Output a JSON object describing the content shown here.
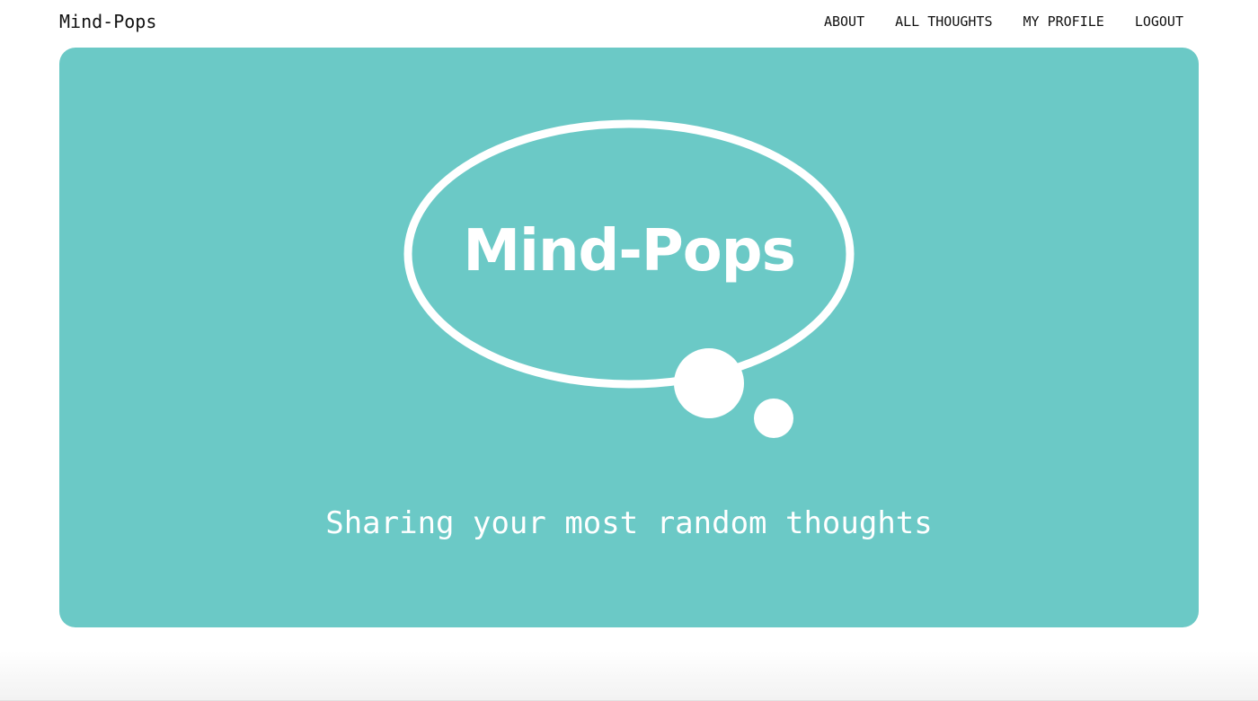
{
  "navbar": {
    "brand": "Mind-Pops",
    "links": [
      {
        "label": "ABOUT"
      },
      {
        "label": "ALL THOUGHTS"
      },
      {
        "label": "MY PROFILE"
      },
      {
        "label": "LOGOUT"
      }
    ]
  },
  "hero": {
    "logo_text": "Mind-Pops",
    "tagline": "Sharing your most random thoughts"
  },
  "colors": {
    "hero_background": "#6BC9C6",
    "logo": "#FFFFFF",
    "nav_text": "#111111"
  },
  "icons": {
    "logo_graphic": "thought-bubble-icon"
  }
}
